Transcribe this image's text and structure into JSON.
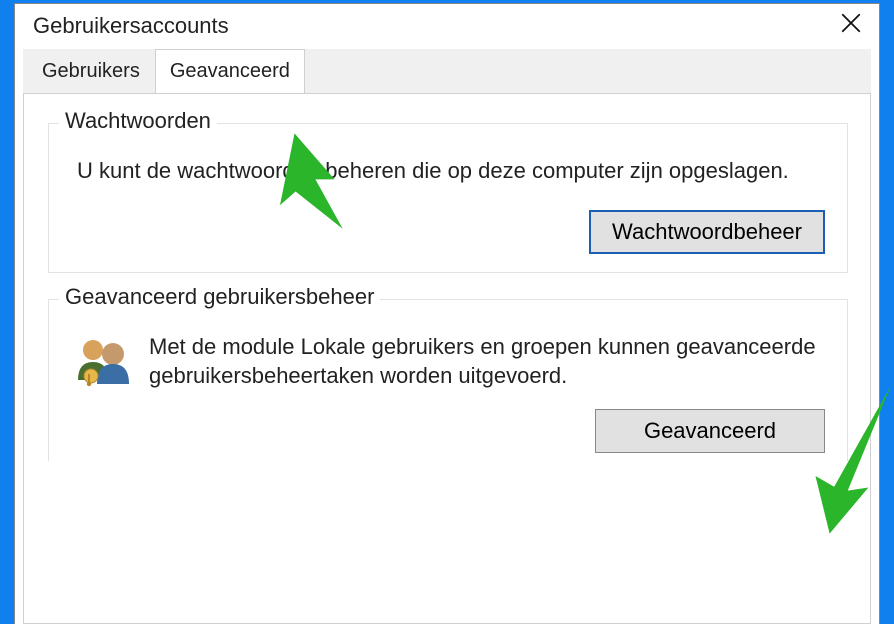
{
  "window": {
    "title": "Gebruikersaccounts"
  },
  "tabs": [
    {
      "label": "Gebruikers"
    },
    {
      "label": "Geavanceerd"
    }
  ],
  "passwords_group": {
    "title": "Wachtwoorden",
    "text": "U kunt de wachtwoorden beheren die op deze computer zijn opgeslagen.",
    "button": "Wachtwoordbeheer"
  },
  "advanced_group": {
    "title": "Geavanceerd gebruikersbeheer",
    "text": "Met de module Lokale gebruikers en groepen kunnen geavanceerde gebruikersbeheertaken worden uitgevoerd.",
    "button": "Geavanceerd"
  }
}
